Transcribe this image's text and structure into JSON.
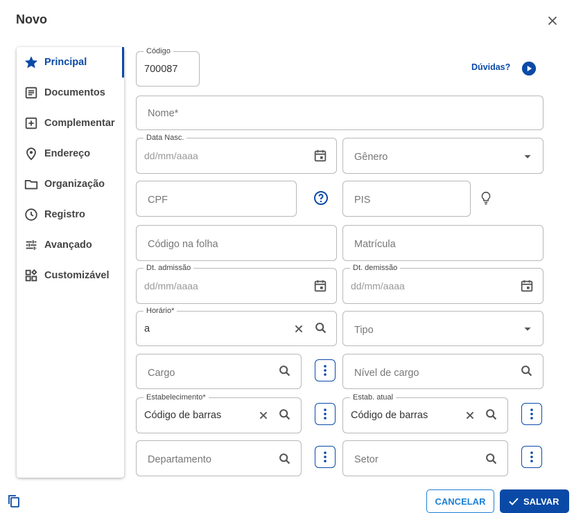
{
  "dialog": {
    "title": "Novo"
  },
  "sidebar": {
    "items": [
      {
        "label": "Principal",
        "icon": "star-icon",
        "active": true
      },
      {
        "label": "Documentos",
        "icon": "document-icon"
      },
      {
        "label": "Complementar",
        "icon": "plus-box-icon"
      },
      {
        "label": "Endereço",
        "icon": "location-pin-icon"
      },
      {
        "label": "Organização",
        "icon": "folder-icon"
      },
      {
        "label": "Registro",
        "icon": "clock-icon"
      },
      {
        "label": "Avançado",
        "icon": "sliders-icon"
      },
      {
        "label": "Customizável",
        "icon": "widgets-icon"
      }
    ]
  },
  "help": {
    "label": "Dúvidas?"
  },
  "form": {
    "codigo": {
      "label": "Código",
      "value": "700087"
    },
    "nome": {
      "placeholder": "Nome*"
    },
    "data_nasc": {
      "label": "Data Nasc.",
      "placeholder": "dd/mm/aaaa"
    },
    "genero": {
      "placeholder": "Gênero"
    },
    "cpf": {
      "placeholder": "CPF"
    },
    "pis": {
      "placeholder": "PIS"
    },
    "codigo_folha": {
      "placeholder": "Código na folha"
    },
    "matricula": {
      "placeholder": "Matrícula"
    },
    "dt_admissao": {
      "label": "Dt. admissão",
      "placeholder": "dd/mm/aaaa"
    },
    "dt_demissao": {
      "label": "Dt. demissão",
      "placeholder": "dd/mm/aaaa"
    },
    "horario": {
      "label": "Horário*",
      "value": "a"
    },
    "tipo": {
      "placeholder": "Tipo"
    },
    "cargo": {
      "placeholder": "Cargo"
    },
    "nivel_cargo": {
      "placeholder": "Nível de cargo"
    },
    "estabelecimento": {
      "label": "Estabelecimento*",
      "value": "Código de barras"
    },
    "estab_atual": {
      "label": "Estab. atual",
      "value": "Código de barras"
    },
    "departamento": {
      "placeholder": "Departamento"
    },
    "setor": {
      "placeholder": "Setor"
    }
  },
  "footer": {
    "cancel_label": "CANCELAR",
    "save_label": "SALVAR"
  },
  "colors": {
    "primary": "#0a4aa6",
    "accent": "#1c7fd6",
    "border": "#b8b8b8"
  }
}
